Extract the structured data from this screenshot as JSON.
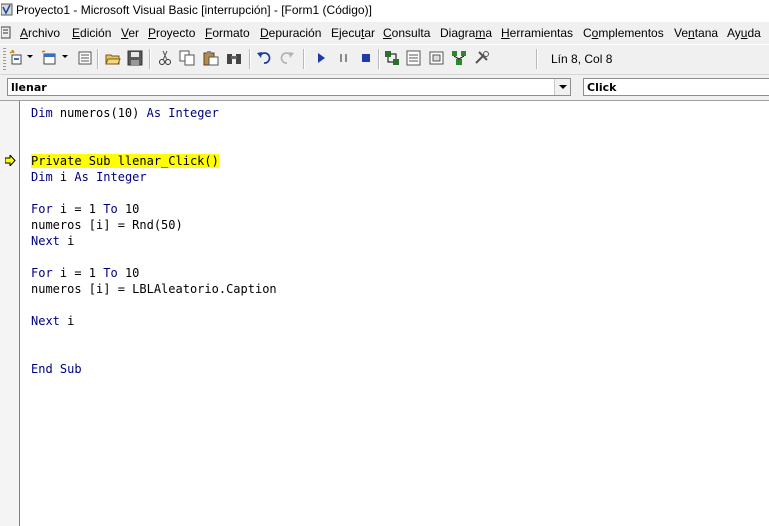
{
  "window": {
    "title": "Proyecto1 - Microsoft Visual Basic [interrupción] - [Form1 (Código)]"
  },
  "menu": {
    "items": [
      {
        "label": "Archivo",
        "ul": "A",
        "rest": "rchivo"
      },
      {
        "label": "Edición",
        "ul": "E",
        "rest": "dición"
      },
      {
        "label": "Ver",
        "ul": "V",
        "rest": "er"
      },
      {
        "label": "Proyecto",
        "ul": "P",
        "rest": "royecto"
      },
      {
        "label": "Formato",
        "ul": "F",
        "rest": "ormato"
      },
      {
        "label": "Depuración",
        "ul": "D",
        "rest": "epuración"
      },
      {
        "label": "Ejecutar",
        "pre": "Ejecu",
        "ul": "t",
        "rest": "ar"
      },
      {
        "label": "Consulta",
        "ul": "C",
        "rest": "onsulta"
      },
      {
        "label": "Diagrama",
        "pre": "Diagra",
        "ul": "m",
        "rest": "a"
      },
      {
        "label": "Herramientas",
        "ul": "H",
        "rest": "erramientas"
      },
      {
        "label": "Complementos",
        "pre": "C",
        "ul": "o",
        "rest": "mplementos"
      },
      {
        "label": "Ventana",
        "pre": "Ve",
        "ul": "n",
        "rest": "tana"
      },
      {
        "label": "Ayuda",
        "pre": "Ay",
        "ul": "u",
        "rest": "da"
      }
    ]
  },
  "toolbar": {
    "cursor_position": "Lín 8, Col 8",
    "icons": [
      "add-project-icon",
      "add-form-icon",
      "menu-editor-icon",
      "open-icon",
      "save-icon",
      "cut-icon",
      "copy-icon",
      "paste-icon",
      "find-icon",
      "undo-icon",
      "redo-icon",
      "run-icon",
      "pause-icon",
      "stop-icon",
      "project-explorer-icon",
      "properties-icon",
      "form-layout-icon",
      "object-browser-icon",
      "toolbox-icon"
    ]
  },
  "combos": {
    "object": "llenar",
    "procedure": "Click"
  },
  "code": {
    "lines": [
      {
        "tokens": [
          {
            "t": "Dim",
            "kw": true
          },
          {
            "t": " numeros(10) "
          },
          {
            "t": "As",
            "kw": true
          },
          {
            "t": " "
          },
          {
            "t": "Integer",
            "kw": true
          }
        ]
      },
      {
        "tokens": []
      },
      {
        "tokens": []
      },
      {
        "highlight": true,
        "tokens": [
          {
            "t": "Private Sub llenar_Click()"
          }
        ]
      },
      {
        "tokens": [
          {
            "t": "Dim",
            "kw": true
          },
          {
            "t": " i "
          },
          {
            "t": "As",
            "kw": true
          },
          {
            "t": " "
          },
          {
            "t": "Integer",
            "kw": true
          }
        ]
      },
      {
        "tokens": []
      },
      {
        "tokens": [
          {
            "t": "For",
            "kw": true
          },
          {
            "t": " i = 1 "
          },
          {
            "t": "To",
            "kw": true
          },
          {
            "t": " 10"
          }
        ]
      },
      {
        "tokens": [
          {
            "t": "numeros [i] = Rnd(50)"
          }
        ]
      },
      {
        "tokens": [
          {
            "t": "Next",
            "kw": true
          },
          {
            "t": " i"
          }
        ]
      },
      {
        "tokens": []
      },
      {
        "tokens": [
          {
            "t": "For",
            "kw": true
          },
          {
            "t": " i = 1 "
          },
          {
            "t": "To",
            "kw": true
          },
          {
            "t": " 10"
          }
        ]
      },
      {
        "tokens": [
          {
            "t": "numeros [i] = LBLAleatorio.Caption"
          }
        ]
      },
      {
        "tokens": []
      },
      {
        "tokens": [
          {
            "t": "Next",
            "kw": true
          },
          {
            "t": " i"
          }
        ]
      },
      {
        "tokens": []
      },
      {
        "tokens": []
      },
      {
        "tokens": [
          {
            "t": "End Sub",
            "kw": true
          }
        ]
      }
    ]
  },
  "colors": {
    "keyword": "#000080",
    "breakpoint_highlight": "#ffff00",
    "execution_arrow": "#ffff00"
  }
}
